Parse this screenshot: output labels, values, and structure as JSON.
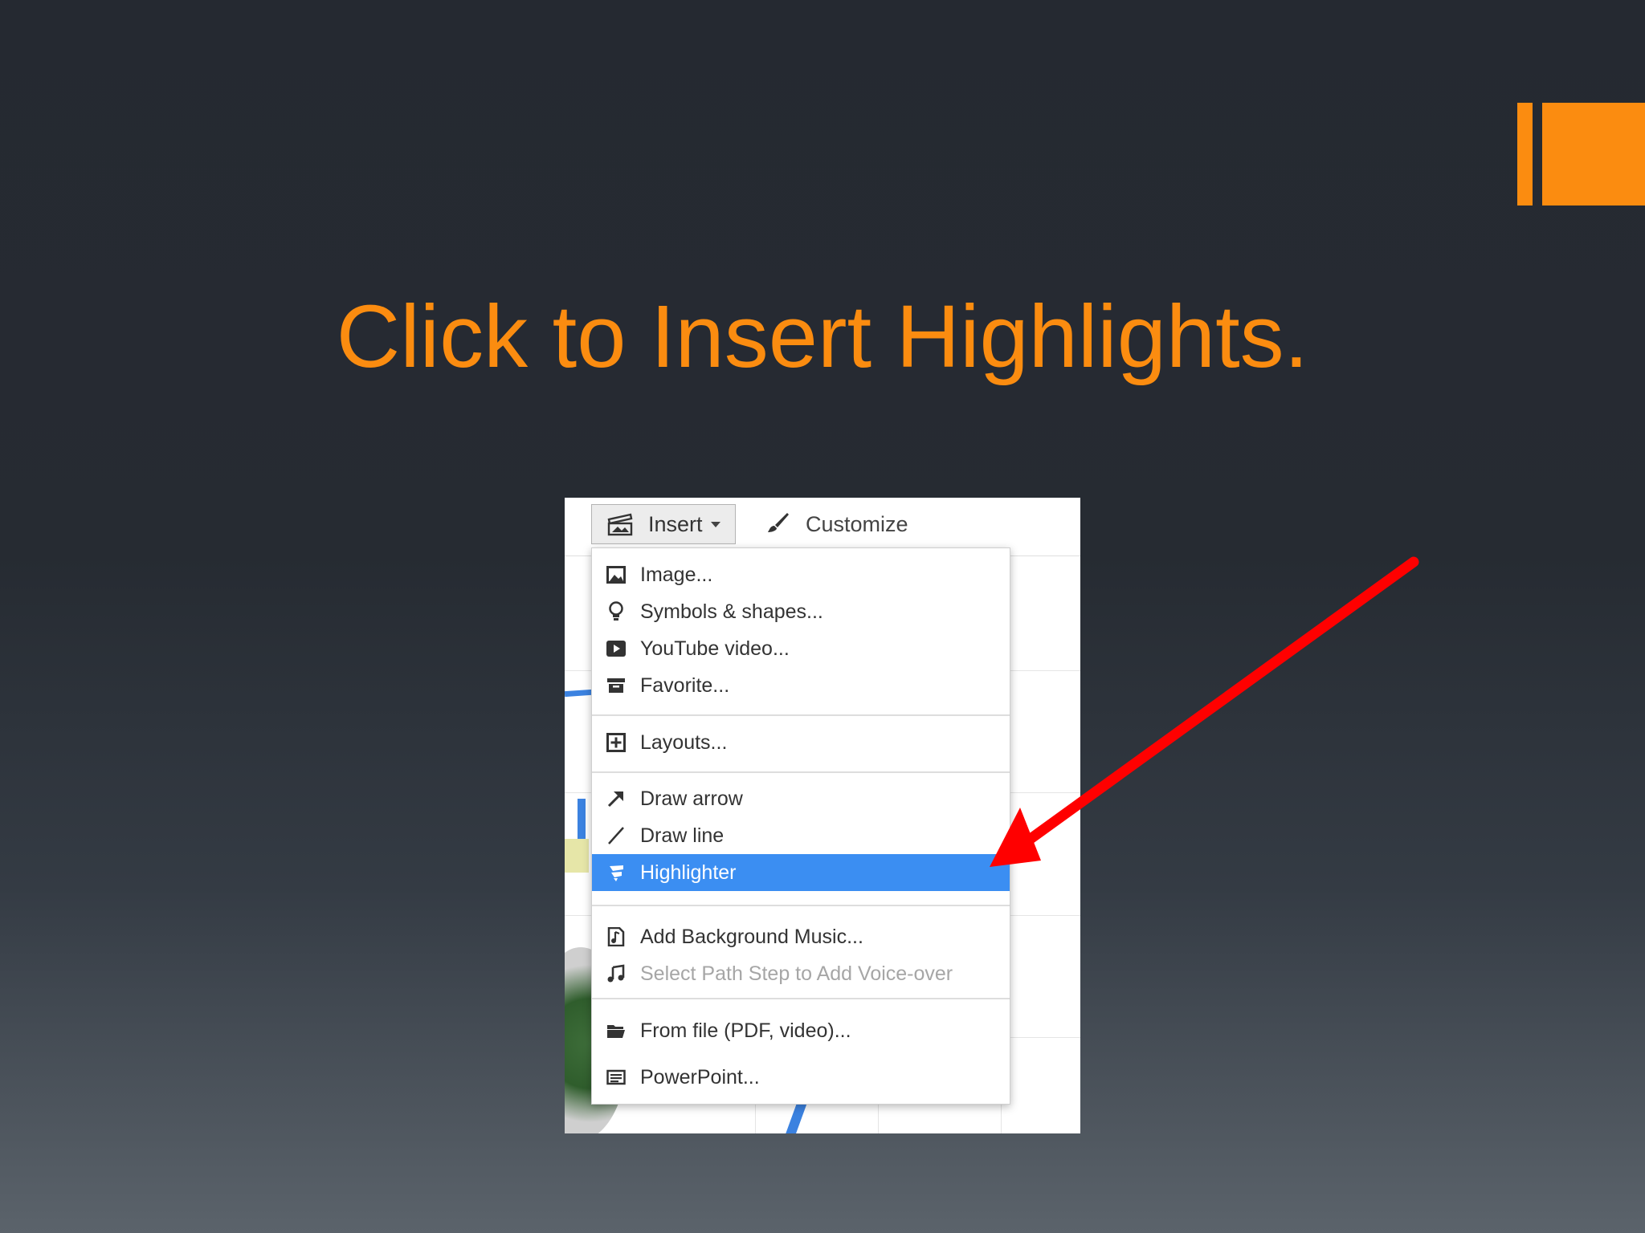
{
  "slide": {
    "title": "Click to Insert Highlights."
  },
  "toolbar": {
    "insert_label": "Insert",
    "customize_label": "Customize"
  },
  "menu": {
    "items": [
      {
        "label": "Image...",
        "icon": "image-icon"
      },
      {
        "label": "Symbols & shapes...",
        "icon": "lightbulb-icon"
      },
      {
        "label": "YouTube video...",
        "icon": "youtube-icon"
      },
      {
        "label": "Favorite...",
        "icon": "archive-box-icon"
      },
      {
        "label": "Layouts...",
        "icon": "add-box-icon"
      },
      {
        "label": "Draw arrow",
        "icon": "arrow-icon"
      },
      {
        "label": "Draw line",
        "icon": "line-icon"
      },
      {
        "label": "Highlighter",
        "icon": "highlighter-icon",
        "selected": true
      },
      {
        "label": "Add Background Music...",
        "icon": "music-file-icon"
      },
      {
        "label": "Select Path Step to Add Voice-over",
        "icon": "music-note-icon",
        "disabled": true
      },
      {
        "label": "From file (PDF, video)...",
        "icon": "folder-icon"
      },
      {
        "label": "PowerPoint...",
        "icon": "presentation-icon"
      }
    ]
  },
  "colors": {
    "accent": "#fb8c10",
    "selection": "#3b8ef2",
    "annotation_arrow": "#ff0000"
  }
}
